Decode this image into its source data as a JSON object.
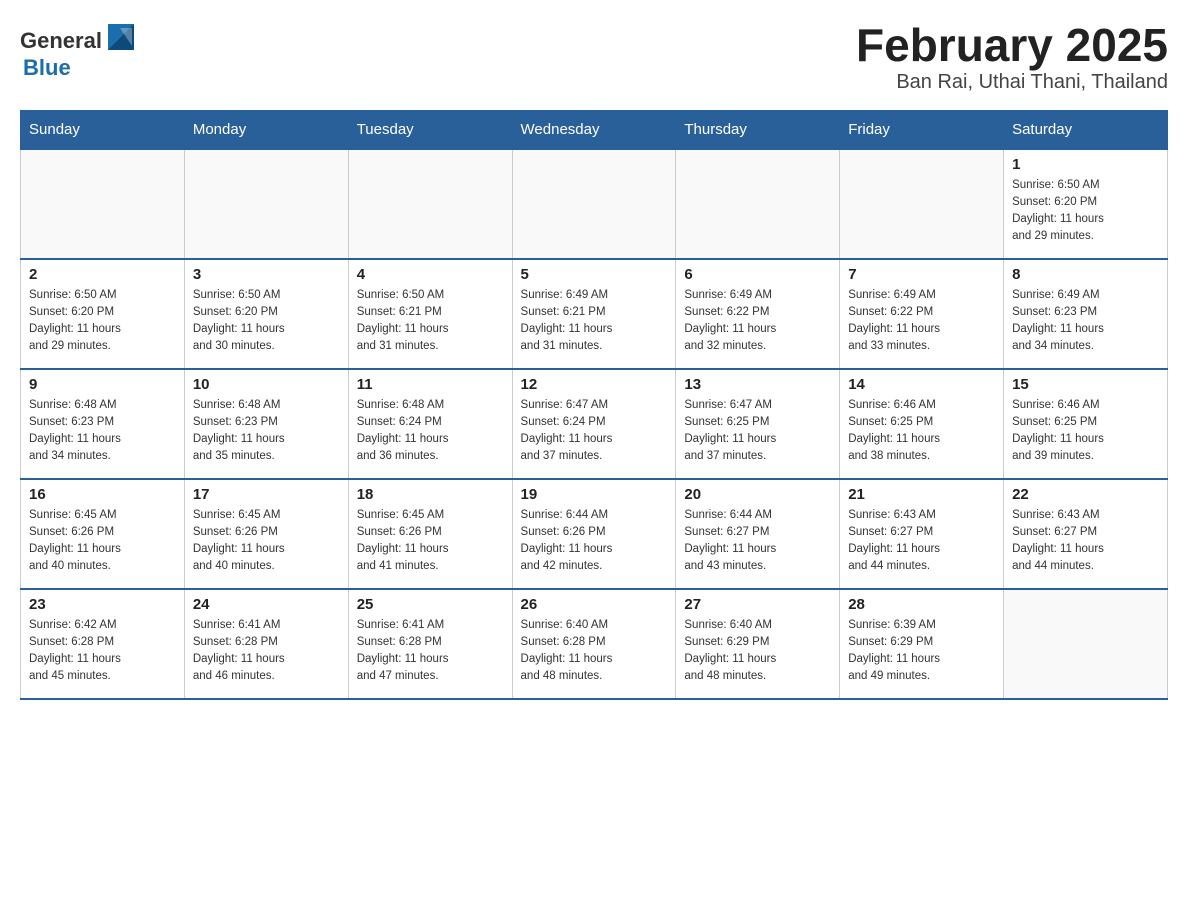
{
  "header": {
    "title": "February 2025",
    "subtitle": "Ban Rai, Uthai Thani, Thailand"
  },
  "logo": {
    "general": "General",
    "blue": "Blue"
  },
  "days_of_week": [
    "Sunday",
    "Monday",
    "Tuesday",
    "Wednesday",
    "Thursday",
    "Friday",
    "Saturday"
  ],
  "weeks": [
    [
      {
        "day": "",
        "info": ""
      },
      {
        "day": "",
        "info": ""
      },
      {
        "day": "",
        "info": ""
      },
      {
        "day": "",
        "info": ""
      },
      {
        "day": "",
        "info": ""
      },
      {
        "day": "",
        "info": ""
      },
      {
        "day": "1",
        "info": "Sunrise: 6:50 AM\nSunset: 6:20 PM\nDaylight: 11 hours\nand 29 minutes."
      }
    ],
    [
      {
        "day": "2",
        "info": "Sunrise: 6:50 AM\nSunset: 6:20 PM\nDaylight: 11 hours\nand 29 minutes."
      },
      {
        "day": "3",
        "info": "Sunrise: 6:50 AM\nSunset: 6:20 PM\nDaylight: 11 hours\nand 30 minutes."
      },
      {
        "day": "4",
        "info": "Sunrise: 6:50 AM\nSunset: 6:21 PM\nDaylight: 11 hours\nand 31 minutes."
      },
      {
        "day": "5",
        "info": "Sunrise: 6:49 AM\nSunset: 6:21 PM\nDaylight: 11 hours\nand 31 minutes."
      },
      {
        "day": "6",
        "info": "Sunrise: 6:49 AM\nSunset: 6:22 PM\nDaylight: 11 hours\nand 32 minutes."
      },
      {
        "day": "7",
        "info": "Sunrise: 6:49 AM\nSunset: 6:22 PM\nDaylight: 11 hours\nand 33 minutes."
      },
      {
        "day": "8",
        "info": "Sunrise: 6:49 AM\nSunset: 6:23 PM\nDaylight: 11 hours\nand 34 minutes."
      }
    ],
    [
      {
        "day": "9",
        "info": "Sunrise: 6:48 AM\nSunset: 6:23 PM\nDaylight: 11 hours\nand 34 minutes."
      },
      {
        "day": "10",
        "info": "Sunrise: 6:48 AM\nSunset: 6:23 PM\nDaylight: 11 hours\nand 35 minutes."
      },
      {
        "day": "11",
        "info": "Sunrise: 6:48 AM\nSunset: 6:24 PM\nDaylight: 11 hours\nand 36 minutes."
      },
      {
        "day": "12",
        "info": "Sunrise: 6:47 AM\nSunset: 6:24 PM\nDaylight: 11 hours\nand 37 minutes."
      },
      {
        "day": "13",
        "info": "Sunrise: 6:47 AM\nSunset: 6:25 PM\nDaylight: 11 hours\nand 37 minutes."
      },
      {
        "day": "14",
        "info": "Sunrise: 6:46 AM\nSunset: 6:25 PM\nDaylight: 11 hours\nand 38 minutes."
      },
      {
        "day": "15",
        "info": "Sunrise: 6:46 AM\nSunset: 6:25 PM\nDaylight: 11 hours\nand 39 minutes."
      }
    ],
    [
      {
        "day": "16",
        "info": "Sunrise: 6:45 AM\nSunset: 6:26 PM\nDaylight: 11 hours\nand 40 minutes."
      },
      {
        "day": "17",
        "info": "Sunrise: 6:45 AM\nSunset: 6:26 PM\nDaylight: 11 hours\nand 40 minutes."
      },
      {
        "day": "18",
        "info": "Sunrise: 6:45 AM\nSunset: 6:26 PM\nDaylight: 11 hours\nand 41 minutes."
      },
      {
        "day": "19",
        "info": "Sunrise: 6:44 AM\nSunset: 6:26 PM\nDaylight: 11 hours\nand 42 minutes."
      },
      {
        "day": "20",
        "info": "Sunrise: 6:44 AM\nSunset: 6:27 PM\nDaylight: 11 hours\nand 43 minutes."
      },
      {
        "day": "21",
        "info": "Sunrise: 6:43 AM\nSunset: 6:27 PM\nDaylight: 11 hours\nand 44 minutes."
      },
      {
        "day": "22",
        "info": "Sunrise: 6:43 AM\nSunset: 6:27 PM\nDaylight: 11 hours\nand 44 minutes."
      }
    ],
    [
      {
        "day": "23",
        "info": "Sunrise: 6:42 AM\nSunset: 6:28 PM\nDaylight: 11 hours\nand 45 minutes."
      },
      {
        "day": "24",
        "info": "Sunrise: 6:41 AM\nSunset: 6:28 PM\nDaylight: 11 hours\nand 46 minutes."
      },
      {
        "day": "25",
        "info": "Sunrise: 6:41 AM\nSunset: 6:28 PM\nDaylight: 11 hours\nand 47 minutes."
      },
      {
        "day": "26",
        "info": "Sunrise: 6:40 AM\nSunset: 6:28 PM\nDaylight: 11 hours\nand 48 minutes."
      },
      {
        "day": "27",
        "info": "Sunrise: 6:40 AM\nSunset: 6:29 PM\nDaylight: 11 hours\nand 48 minutes."
      },
      {
        "day": "28",
        "info": "Sunrise: 6:39 AM\nSunset: 6:29 PM\nDaylight: 11 hours\nand 49 minutes."
      },
      {
        "day": "",
        "info": ""
      }
    ]
  ]
}
